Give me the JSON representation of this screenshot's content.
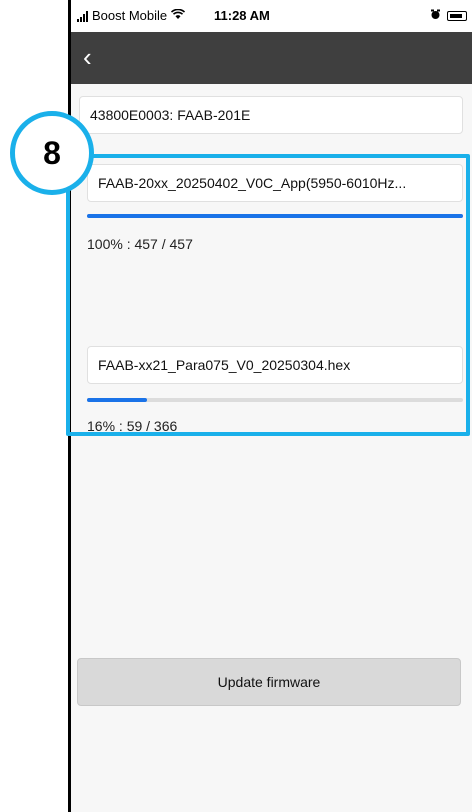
{
  "status_bar": {
    "carrier": "Boost Mobile",
    "time": "11:28 AM"
  },
  "nav": {
    "back_label": "‹"
  },
  "device": {
    "value": "43800E0003: FAAB-201E"
  },
  "firmware_files": [
    {
      "name": "FAAB-20xx_20250402_V0C_App(5950-6010Hz...",
      "progress_text": "100% : 457 / 457",
      "progress_fraction": 1.0
    },
    {
      "name": "FAAB-xx21_Para075_V0_20250304.hex",
      "progress_text": "16% : 59 / 366",
      "progress_fraction": 0.16
    }
  ],
  "actions": {
    "update_label": "Update firmware"
  },
  "annotation": {
    "step_number": "8",
    "accent_color": "#1ab0ea"
  },
  "colors": {
    "nav_bar": "#3f3f3f",
    "progress": "#1a73e8",
    "button": "#d9d9d9"
  }
}
